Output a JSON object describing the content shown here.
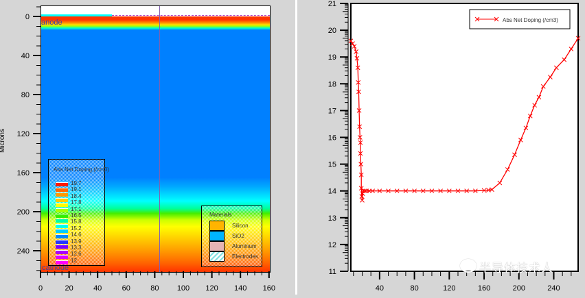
{
  "left_plot": {
    "y_axis_label": "Microns",
    "y_ticks": [
      "0",
      "40",
      "80",
      "120",
      "160",
      "200",
      "240"
    ],
    "x_ticks": [
      "0",
      "20",
      "40",
      "60",
      "80",
      "100",
      "120",
      "140",
      "160"
    ],
    "electrode_top": "anode",
    "electrode_bottom": "cathode",
    "doping_legend": {
      "title": "Abs Net Doping (/cm3)",
      "levels": [
        "19.7",
        "19.1",
        "18.4",
        "17.8",
        "17.1",
        "16.5",
        "15.8",
        "15.2",
        "14.6",
        "13.9",
        "13.3",
        "12.6",
        "12"
      ],
      "colors": [
        "#ff1a00",
        "#ff6600",
        "#ff9900",
        "#ffcc00",
        "#ffff00",
        "#aaff00",
        "#33ee00",
        "#00ffaa",
        "#00ffee",
        "#00ccff",
        "#0088ff",
        "#2233ff",
        "#7700ff",
        "#aa00ff",
        "#dd00ff",
        "#ff00ff"
      ]
    },
    "materials_legend": {
      "title": "Materials",
      "items": [
        {
          "label": "Silicon",
          "color": "#ffb400"
        },
        {
          "label": "SiO2",
          "color": "#00b4ff"
        },
        {
          "label": "Aluminum",
          "color": "#e6b4b4"
        },
        {
          "label": "Electrodes",
          "color": "#80e0e0"
        }
      ]
    }
  },
  "chart_data": {
    "type": "line",
    "title": "",
    "xlabel": "",
    "ylabel": "",
    "xlim": [
      7,
      268
    ],
    "ylim": [
      11,
      21
    ],
    "x_ticks": [
      40,
      80,
      120,
      160,
      200,
      240
    ],
    "y_ticks": [
      11,
      12,
      13,
      14,
      15,
      16,
      17,
      18,
      19,
      20,
      21
    ],
    "legend_position": "top-right",
    "series": [
      {
        "name": "Abs Net Doping (/cm3)",
        "color": "#ff0000",
        "marker": "x",
        "x": [
          7,
          9,
          11,
          13,
          14,
          15,
          15.5,
          16,
          16.5,
          17,
          17.5,
          18,
          18,
          18.5,
          19,
          19,
          19.5,
          20,
          20.5,
          21,
          23,
          25,
          28,
          32,
          40,
          50,
          60,
          70,
          80,
          90,
          100,
          110,
          120,
          130,
          140,
          150,
          160,
          165,
          169,
          178,
          187,
          195,
          202,
          208,
          213,
          218,
          223,
          228,
          236,
          243,
          252,
          260,
          268
        ],
        "y": [
          19.6,
          19.5,
          19.4,
          19.2,
          18.95,
          18.6,
          18.05,
          17.7,
          17.0,
          16.4,
          16.0,
          15.8,
          15.4,
          15.0,
          14.6,
          14.1,
          13.8,
          13.65,
          13.9,
          14.0,
          14.0,
          14.0,
          14.0,
          14.0,
          14.0,
          14.0,
          14.0,
          14.0,
          14.0,
          14.0,
          14.0,
          14.0,
          14.0,
          14.0,
          14.0,
          14.0,
          14.02,
          14.03,
          14.05,
          14.3,
          14.8,
          15.35,
          15.9,
          16.35,
          16.8,
          17.2,
          17.5,
          17.9,
          18.25,
          18.6,
          18.9,
          19.3,
          19.7
        ]
      }
    ]
  },
  "watermark": "半导体技术人"
}
